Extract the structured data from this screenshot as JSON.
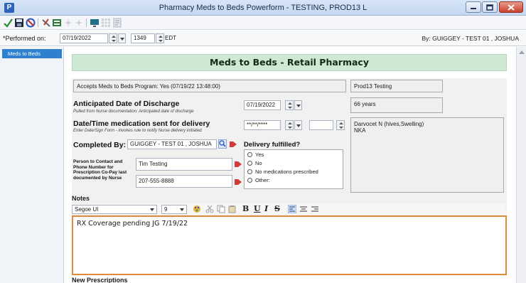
{
  "window": {
    "app_icon_letter": "P",
    "title": "Pharmacy Meds to Beds Powerform - TESTING, PROD13 L"
  },
  "toolbar": {
    "icons": [
      "checkmark-icon",
      "save-icon",
      "cancel-icon",
      "tools-icon",
      "form-icon",
      "star-icon",
      "star-icon",
      "monitor-icon",
      "grid-icon",
      "document-icon"
    ]
  },
  "performed": {
    "label": "*Performed on:",
    "date": "07/19/2022",
    "time": "1349",
    "timezone": "EDT",
    "by": "By:  GUIGGEY - TEST 01 , JOSHUA"
  },
  "sidebar": {
    "items": [
      {
        "label": "Meds to Beds"
      }
    ]
  },
  "form": {
    "banner": "Meds to Beds - Retail Pharmacy",
    "accepts": "Accepts Meds to Beds Program: Yes (07/19/22 13:48:00)",
    "patient_name": "Prod13 Testing",
    "discharge": {
      "label": "Anticipated Date of Discharge",
      "sub": "Pulled from Nurse documentation: Anticipated date of discharge",
      "date": "07/19/2022"
    },
    "age": "66 years",
    "delivery": {
      "label": "Date/Time medication sent for delivery",
      "sub": "Enter Date/Sign Form - invokes rule to notify Nurse delivery initiated.",
      "date": "**/**/****",
      "time": ""
    },
    "allergies": [
      "Darvocet N (hives,Swelling)",
      "NKA"
    ],
    "completed_by": {
      "label": "Completed By:",
      "value": "GUIGGEY - TEST 01 , JOSHUA"
    },
    "delivery_fulfilled": {
      "label": "Delivery fulfilled?",
      "options": [
        "Yes",
        "No",
        "No medications prescribed",
        "Other:"
      ]
    },
    "contact": {
      "label": "Person to Contact and Phone Number for Prescription Co-Pay last documented by Nurse",
      "name": "Tim Testing",
      "phone": "207-555-8888"
    },
    "notes": {
      "title": "Notes",
      "font": "Segoe UI",
      "size": "9",
      "format_buttons": [
        "B",
        "U",
        "I",
        "S"
      ],
      "text": "RX Coverage pending JG 7/19/22"
    },
    "new_prescriptions": "New Prescriptions"
  },
  "colors": {
    "banner_bg": "#cfe8d4",
    "sidebar_selected": "#2f80d0",
    "notes_border": "#e08a3c"
  }
}
